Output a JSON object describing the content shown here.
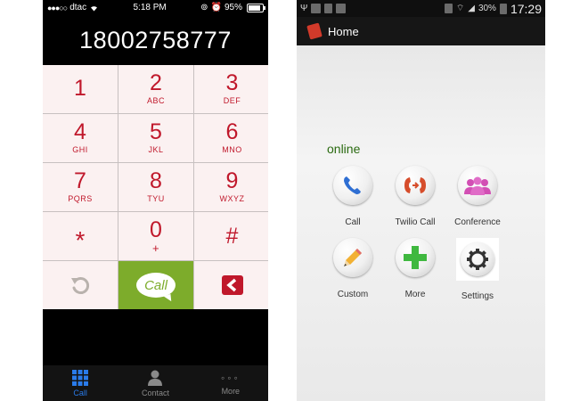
{
  "ios": {
    "status": {
      "carrier": "dtac",
      "time": "5:18 PM",
      "battery": "95%"
    },
    "number": "18002758777",
    "keys": [
      {
        "digit": "1",
        "letters": ""
      },
      {
        "digit": "2",
        "letters": "ABC"
      },
      {
        "digit": "3",
        "letters": "DEF"
      },
      {
        "digit": "4",
        "letters": "GHI"
      },
      {
        "digit": "5",
        "letters": "JKL"
      },
      {
        "digit": "6",
        "letters": "MNO"
      },
      {
        "digit": "7",
        "letters": "PQRS"
      },
      {
        "digit": "8",
        "letters": "TYU"
      },
      {
        "digit": "9",
        "letters": "WXYZ"
      },
      {
        "digit": "*",
        "letters": ""
      },
      {
        "digit": "0",
        "letters": "+"
      },
      {
        "digit": "#",
        "letters": ""
      }
    ],
    "call_label": "Call",
    "tabs": [
      {
        "label": "Call"
      },
      {
        "label": "Contact"
      },
      {
        "label": "More"
      }
    ],
    "colors": {
      "key_text": "#c0182b",
      "key_bg": "#fbf1f1",
      "call_green": "#7dac2b",
      "tab_active": "#2a7bea"
    }
  },
  "android": {
    "status": {
      "battery": "30%",
      "time": "17:29"
    },
    "title": "Home",
    "status_label": "online",
    "tiles": [
      {
        "label": "Call",
        "icon": "phone-handset-icon"
      },
      {
        "label": "Twilio Call",
        "icon": "twilio-call-icon"
      },
      {
        "label": "Conference",
        "icon": "conference-people-icon"
      },
      {
        "label": "Custom",
        "icon": "pencil-icon"
      },
      {
        "label": "More",
        "icon": "plus-icon"
      },
      {
        "label": "Settings",
        "icon": "gear-icon"
      }
    ],
    "colors": {
      "online_text": "#2a6a10",
      "plus_green": "#3fb83f",
      "conference_pink": "#d24fb4",
      "twilio_red": "#d64d2b"
    }
  }
}
